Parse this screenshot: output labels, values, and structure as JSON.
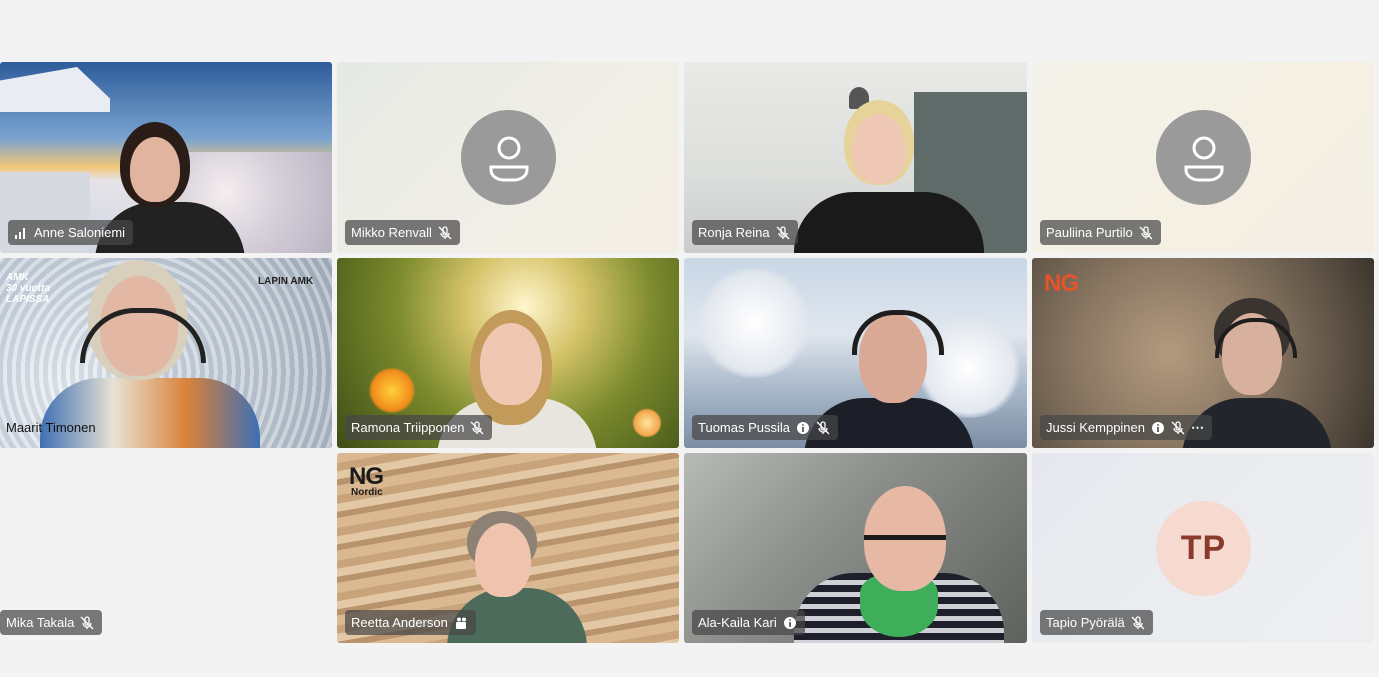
{
  "participants": [
    {
      "name": "Anne Saloniemi",
      "muted": false,
      "signal": true
    },
    {
      "name": "Mikko Renvall",
      "muted": true,
      "avatar": "person-icon"
    },
    {
      "name": "Ronja Reina",
      "muted": true
    },
    {
      "name": "Pauliina Purtilo",
      "muted": true,
      "avatar": "person-icon"
    },
    {
      "name": "Maarit Timonen",
      "muted": false
    },
    {
      "name": "Ramona Triipponen",
      "muted": true
    },
    {
      "name": "Tuomas Pussila",
      "muted": true,
      "badge": "info-icon"
    },
    {
      "name": "Jussi Kemppinen",
      "muted": true,
      "badge": "info-icon",
      "more": "⋯"
    },
    {
      "name": "Mika Takala",
      "muted": true
    },
    {
      "name": "Reetta Anderson",
      "muted": false,
      "badge": "collab-icon"
    },
    {
      "name": "Ala-Kaila Kari",
      "muted": false,
      "badge": "info-icon"
    },
    {
      "name": "Tapio Pyörälä",
      "muted": true,
      "initials": "TP"
    }
  ],
  "backgrounds": {
    "maarit_logo_left": "AMK\n30 vuotta\nLAPISSA",
    "maarit_logo_right": "LAPIN AMK",
    "jussi_logo": "NG",
    "reetta_logo_ng": "NG",
    "reetta_logo_nordic": "Nordic"
  },
  "colors": {
    "pill_bg": "#464646",
    "avatar_gray": "#9a9a9a",
    "initials_bg": "#f6d9cf",
    "initials_fg": "#8a3a2b",
    "ng_orange": "#e8542a"
  }
}
